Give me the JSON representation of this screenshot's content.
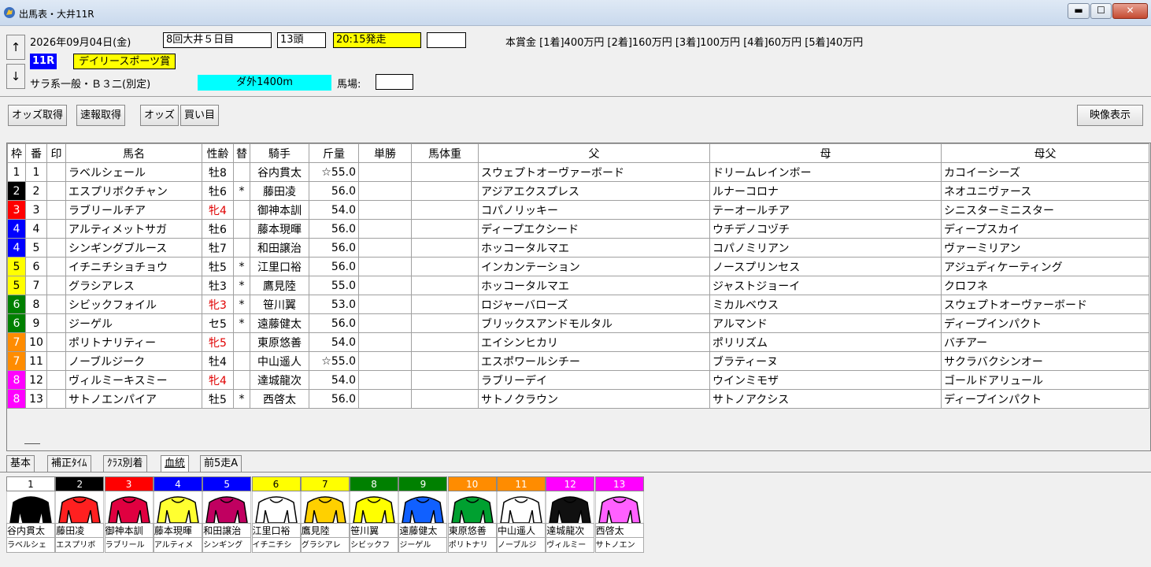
{
  "window": {
    "title": "出馬表・大井11R"
  },
  "header": {
    "date": "2026年09月04日(金)",
    "meeting": "8回大井５日目",
    "runners": "13頭",
    "post_time": "20:15発走",
    "post_time_extra": "",
    "race_no": "11R",
    "race_name": "デイリースポーツ賞",
    "race_class": "サラ系一般・Ｂ３二(別定)",
    "course": "ダ外1400m",
    "track_label": "馬場:",
    "track_value": "",
    "prize": "本賞金 [1着]400万円 [2着]160万円 [3着]100万円 [4着]60万円 [5着]40万円",
    "up_arrow": "↑",
    "down_arrow": "↓"
  },
  "toolbar": {
    "odds_fetch": "オッズ取得",
    "flash_fetch": "速報取得",
    "odds": "オッズ",
    "buy": "買い目",
    "video": "映像表示"
  },
  "columns": [
    "枠",
    "番",
    "印",
    "馬名",
    "性齢",
    "替",
    "騎手",
    "斤量",
    "単勝",
    "馬体重",
    "父",
    "母",
    "母父"
  ],
  "colors": {
    "1": "#ffffff",
    "2": "#000000",
    "3": "#ff0000",
    "4": "#0000ff",
    "5": "#ffff00",
    "6": "#008000",
    "7": "#ff8c00",
    "8": "#ff00ff"
  },
  "entries": [
    {
      "waku": "1",
      "num": "1",
      "horse": "ラベルシェール",
      "sexage": "牡8",
      "change": "",
      "jockey": "谷内貫太",
      "weight": "☆55.0",
      "sire": "スウェプトオーヴァーボード",
      "dam": "ドリームレインボー",
      "damsire": "カコイーシーズ"
    },
    {
      "waku": "2",
      "num": "2",
      "horse": "エスプリボクチャン",
      "sexage": "牡6",
      "change": "*",
      "jockey": "藤田凌",
      "weight": "56.0",
      "sire": "アジアエクスプレス",
      "dam": "ルナーコロナ",
      "damsire": "ネオユニヴァース"
    },
    {
      "waku": "3",
      "num": "3",
      "horse": "ラブリールチア",
      "sexage": "牝4",
      "change": "",
      "jockey": "御神本訓",
      "weight": "54.0",
      "sire": "コパノリッキー",
      "dam": "テーオールチア",
      "damsire": "シニスターミニスター"
    },
    {
      "waku": "4",
      "num": "4",
      "horse": "アルティメットサガ",
      "sexage": "牡6",
      "change": "",
      "jockey": "藤本現暉",
      "weight": "56.0",
      "sire": "ディープエクシード",
      "dam": "ウチデノコヅチ",
      "damsire": "ディープスカイ"
    },
    {
      "waku": "4",
      "num": "5",
      "horse": "シンギングブルース",
      "sexage": "牡7",
      "change": "",
      "jockey": "和田譲治",
      "weight": "56.0",
      "sire": "ホッコータルマエ",
      "dam": "コパノミリアン",
      "damsire": "ヴァーミリアン"
    },
    {
      "waku": "5",
      "num": "6",
      "horse": "イチニチショチョウ",
      "sexage": "牡5",
      "change": "*",
      "jockey": "江里口裕",
      "weight": "56.0",
      "sire": "インカンテーション",
      "dam": "ノースプリンセス",
      "damsire": "アジュディケーティング"
    },
    {
      "waku": "5",
      "num": "7",
      "horse": "グラシアレス",
      "sexage": "牡3",
      "change": "*",
      "jockey": "鷹見陸",
      "weight": "55.0",
      "sire": "ホッコータルマエ",
      "dam": "ジャストジョーイ",
      "damsire": "クロフネ"
    },
    {
      "waku": "6",
      "num": "8",
      "horse": "シビックフォイル",
      "sexage": "牝3",
      "change": "*",
      "jockey": "笹川翼",
      "weight": "53.0",
      "sire": "ロジャーバローズ",
      "dam": "ミカルベウス",
      "damsire": "スウェプトオーヴァーボード"
    },
    {
      "waku": "6",
      "num": "9",
      "horse": "ジーゲル",
      "sexage": "セ5",
      "change": "*",
      "jockey": "遠藤健太",
      "weight": "56.0",
      "sire": "ブリックスアンドモルタル",
      "dam": "アルマンド",
      "damsire": "ディープインパクト"
    },
    {
      "waku": "7",
      "num": "10",
      "horse": "ポリトナリティー",
      "sexage": "牝5",
      "change": "",
      "jockey": "東原悠善",
      "weight": "54.0",
      "sire": "エイシンヒカリ",
      "dam": "ポリリズム",
      "damsire": "バチアー"
    },
    {
      "waku": "7",
      "num": "11",
      "horse": "ノーブルジーク",
      "sexage": "牡4",
      "change": "",
      "jockey": "中山遥人",
      "weight": "☆55.0",
      "sire": "エスポワールシチー",
      "dam": "ブラティーヌ",
      "damsire": "サクラバクシンオー"
    },
    {
      "waku": "8",
      "num": "12",
      "horse": "ヴィルミーキスミー",
      "sexage": "牝4",
      "change": "",
      "jockey": "達城龍次",
      "weight": "54.0",
      "sire": "ラブリーデイ",
      "dam": "ウインミモザ",
      "damsire": "ゴールドアリュール"
    },
    {
      "waku": "8",
      "num": "13",
      "horse": "サトノエンパイア",
      "sexage": "牡5",
      "change": "*",
      "jockey": "西啓太",
      "weight": "56.0",
      "sire": "サトノクラウン",
      "dam": "サトノアクシス",
      "damsire": "ディープインパクト"
    }
  ],
  "tabs": [
    "基本",
    "補正ﾀｲﾑ",
    "ｸﾗｽ別着",
    "血統",
    "前5走A"
  ],
  "silks": [
    {
      "num": "1",
      "jockey": "谷内貫太",
      "horse": "ラベルシェ"
    },
    {
      "num": "2",
      "jockey": "藤田凌",
      "horse": "エスプリボ"
    },
    {
      "num": "3",
      "jockey": "御神本訓",
      "horse": "ラブリール"
    },
    {
      "num": "4",
      "jockey": "藤本現暉",
      "horse": "アルティメ"
    },
    {
      "num": "5",
      "jockey": "和田譲治",
      "horse": "シンギング"
    },
    {
      "num": "6",
      "jockey": "江里口裕",
      "horse": "イチニチシ"
    },
    {
      "num": "7",
      "jockey": "鷹見陸",
      "horse": "グラシアレ"
    },
    {
      "num": "8",
      "jockey": "笹川翼",
      "horse": "シビックフ"
    },
    {
      "num": "9",
      "jockey": "遠藤健太",
      "horse": "ジーゲル"
    },
    {
      "num": "10",
      "jockey": "東原悠善",
      "horse": "ポリトナリ"
    },
    {
      "num": "11",
      "jockey": "中山遥人",
      "horse": "ノーブルジ"
    },
    {
      "num": "12",
      "jockey": "達城龍次",
      "horse": "ヴィルミー"
    },
    {
      "num": "13",
      "jockey": "西啓太",
      "horse": "サトノエン"
    }
  ]
}
